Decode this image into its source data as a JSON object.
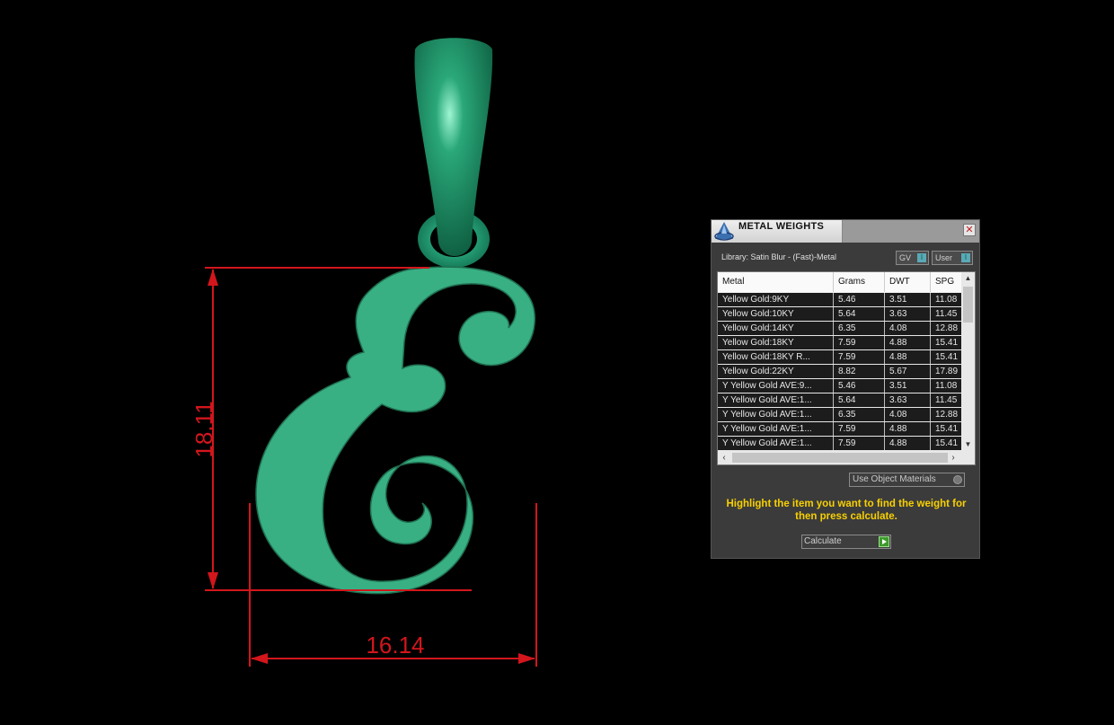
{
  "viewport": {
    "dimension_height": "18.11",
    "dimension_width": "16.14",
    "dimension_color": "#d2161c",
    "model_color": "#38b084",
    "bail_color": "#1e8a62"
  },
  "panel": {
    "title": "METAL WEIGHTS",
    "close_label": "✕",
    "library_label": "Library: Satin Blur - (Fast)-Metal",
    "toggle_gv": "GV",
    "toggle_user": "User",
    "toggle_state": "I",
    "columns": [
      "Metal",
      "Grams",
      "DWT",
      "SPG"
    ],
    "rows": [
      [
        "Yellow Gold:9KY",
        "5.46",
        "3.51",
        "11.08"
      ],
      [
        "Yellow Gold:10KY",
        "5.64",
        "3.63",
        "11.45"
      ],
      [
        "Yellow Gold:14KY",
        "6.35",
        "4.08",
        "12.88"
      ],
      [
        "Yellow Gold:18KY",
        "7.59",
        "4.88",
        "15.41"
      ],
      [
        "Yellow Gold:18KY R...",
        "7.59",
        "4.88",
        "15.41"
      ],
      [
        "Yellow Gold:22KY",
        "8.82",
        "5.67",
        "17.89"
      ],
      [
        "Y Yellow Gold AVE:9...",
        "5.46",
        "3.51",
        "11.08"
      ],
      [
        "Y Yellow Gold AVE:1...",
        "5.64",
        "3.63",
        "11.45"
      ],
      [
        "Y Yellow Gold AVE:1...",
        "6.35",
        "4.08",
        "12.88"
      ],
      [
        "Y Yellow Gold AVE:1...",
        "7.59",
        "4.88",
        "15.41"
      ],
      [
        "Y Yellow Gold AVE:1...",
        "7.59",
        "4.88",
        "15.41"
      ]
    ],
    "material_dropdown": "Use Object Materials",
    "hint": "Highlight the item you want to find the weight for then press calculate.",
    "calculate_label": "Calculate",
    "hint_color": "#f7d000"
  }
}
